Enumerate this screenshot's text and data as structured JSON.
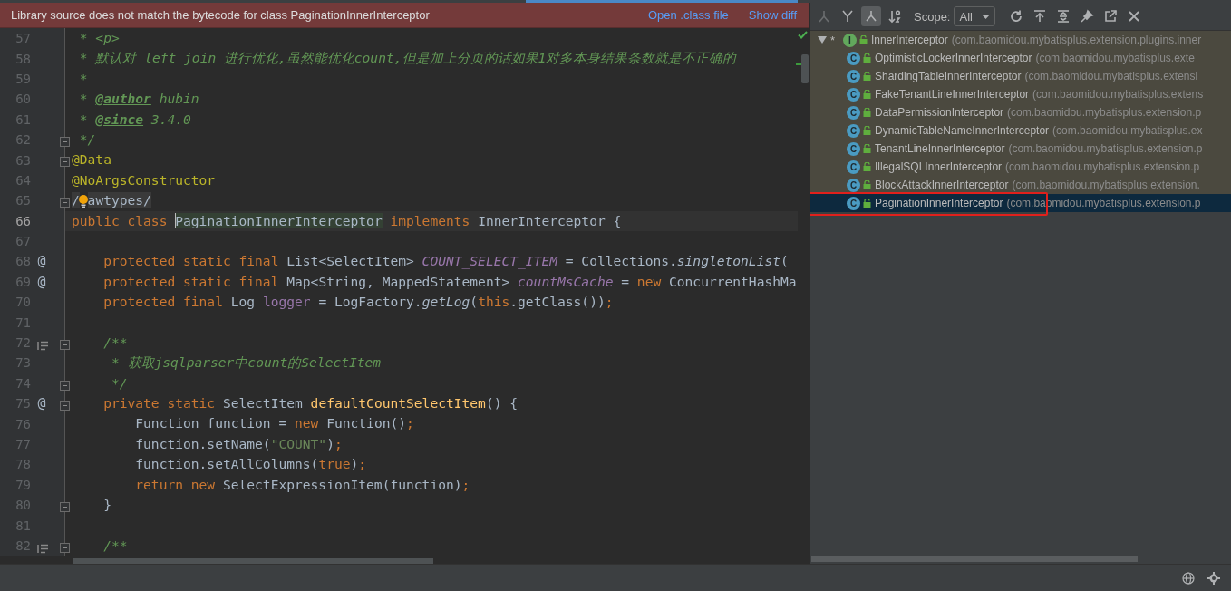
{
  "editor": {
    "banner": {
      "message": "Library source does not match the bytecode for class PaginationInnerInterceptor",
      "links": [
        "Open .class file",
        "Show diff"
      ]
    },
    "lines": [
      {
        "number": "57",
        "fold": false,
        "tokens": [
          {
            "text": " * <p>",
            "kind": "doc"
          }
        ]
      },
      {
        "number": "58",
        "fold": false,
        "tokens": [
          {
            "text": " * 默认对 left join 进行优化,虽然能优化count,但是加上分页的话如果1对多本身结果条数就是不正确的",
            "kind": "doc"
          }
        ]
      },
      {
        "number": "59",
        "fold": false,
        "tokens": [
          {
            "text": " *",
            "kind": "doc"
          }
        ]
      },
      {
        "number": "60",
        "fold": false,
        "tokens": [
          {
            "text": " * ",
            "kind": "doc"
          },
          {
            "text": "@author",
            "kind": "doctag"
          },
          {
            "text": " hubin",
            "kind": "doc"
          }
        ]
      },
      {
        "number": "61",
        "fold": false,
        "tokens": [
          {
            "text": " * ",
            "kind": "doc"
          },
          {
            "text": "@since",
            "kind": "doctag"
          },
          {
            "text": " 3.4.0",
            "kind": "doc"
          }
        ]
      },
      {
        "number": "62",
        "fold": true,
        "tokens": [
          {
            "text": " */",
            "kind": "doc"
          }
        ]
      },
      {
        "number": "63",
        "fold": true,
        "tokens": [
          {
            "text": "@Data",
            "kind": "annotation"
          }
        ]
      },
      {
        "number": "64",
        "fold": false,
        "tokens": [
          {
            "text": "@NoArgsConstructor",
            "kind": "annotation"
          }
        ]
      },
      {
        "number": "65",
        "fold": true,
        "bulb": true,
        "tokens": [
          {
            "text": "/",
            "kind": "folded"
          },
          {
            "text": "awtypes/",
            "kind": "folded"
          }
        ]
      },
      {
        "number": "66",
        "fold": false,
        "current": true,
        "tokens": [
          {
            "text": "public class ",
            "kind": "keyword"
          },
          {
            "text": "PaginationInnerInterceptor",
            "kind": "caret-highlight"
          },
          {
            "text": " implements ",
            "kind": "keyword"
          },
          {
            "text": "InnerInterceptor {",
            "kind": "plain"
          }
        ]
      },
      {
        "number": "67",
        "fold": false
      },
      {
        "number": "68",
        "fold": false,
        "marker": "@",
        "tokens": [
          {
            "text": "    protected static final ",
            "kind": "keyword"
          },
          {
            "text": "List<SelectItem> ",
            "kind": "plain"
          },
          {
            "text": "COUNT_SELECT_ITEM",
            "kind": "constant"
          },
          {
            "text": " = Collections.",
            "kind": "plain"
          },
          {
            "text": "singletonList",
            "kind": "static-call"
          },
          {
            "text": "(",
            "kind": "plain"
          }
        ]
      },
      {
        "number": "69",
        "fold": false,
        "marker": "@",
        "tokens": [
          {
            "text": "    protected static final ",
            "kind": "keyword"
          },
          {
            "text": "Map<String, MappedStatement> ",
            "kind": "plain"
          },
          {
            "text": "countMsCache",
            "kind": "constant"
          },
          {
            "text": " = ",
            "kind": "plain"
          },
          {
            "text": "new ",
            "kind": "keyword"
          },
          {
            "text": "ConcurrentHashMa",
            "kind": "plain"
          }
        ]
      },
      {
        "number": "70",
        "fold": false,
        "tokens": [
          {
            "text": "    protected final ",
            "kind": "keyword"
          },
          {
            "text": "Log ",
            "kind": "plain"
          },
          {
            "text": "logger",
            "kind": "field"
          },
          {
            "text": " = LogFactory.",
            "kind": "plain"
          },
          {
            "text": "getLog",
            "kind": "static-call"
          },
          {
            "text": "(",
            "kind": "plain"
          },
          {
            "text": "this",
            "kind": "keyword"
          },
          {
            "text": ".getClass())",
            "kind": "plain"
          },
          {
            "text": ";",
            "kind": "keyword"
          }
        ]
      },
      {
        "number": "71",
        "fold": false
      },
      {
        "number": "72",
        "fold": true,
        "doc_toggle": true,
        "tokens": [
          {
            "text": "    /**",
            "kind": "doc"
          }
        ]
      },
      {
        "number": "73",
        "fold": false,
        "tokens": [
          {
            "text": "     * 获取jsqlparser中count的SelectItem",
            "kind": "doc"
          }
        ]
      },
      {
        "number": "74",
        "fold": true,
        "tokens": [
          {
            "text": "     */",
            "kind": "doc"
          }
        ]
      },
      {
        "number": "75",
        "fold": true,
        "marker": "@",
        "tokens": [
          {
            "text": "    private static ",
            "kind": "keyword"
          },
          {
            "text": "SelectItem ",
            "kind": "plain"
          },
          {
            "text": "defaultCountSelectItem",
            "kind": "method"
          },
          {
            "text": "() {",
            "kind": "plain"
          }
        ]
      },
      {
        "number": "76",
        "fold": false,
        "tokens": [
          {
            "text": "        Function function = ",
            "kind": "plain"
          },
          {
            "text": "new ",
            "kind": "keyword"
          },
          {
            "text": "Function()",
            "kind": "plain"
          },
          {
            "text": ";",
            "kind": "keyword"
          }
        ]
      },
      {
        "number": "77",
        "fold": false,
        "tokens": [
          {
            "text": "        function.setName(",
            "kind": "plain"
          },
          {
            "text": "\"COUNT\"",
            "kind": "string"
          },
          {
            "text": ")",
            "kind": "plain"
          },
          {
            "text": ";",
            "kind": "keyword"
          }
        ]
      },
      {
        "number": "78",
        "fold": false,
        "tokens": [
          {
            "text": "        function.setAllColumns(",
            "kind": "plain"
          },
          {
            "text": "true",
            "kind": "keyword"
          },
          {
            "text": ")",
            "kind": "plain"
          },
          {
            "text": ";",
            "kind": "keyword"
          }
        ]
      },
      {
        "number": "79",
        "fold": false,
        "tokens": [
          {
            "text": "        return new ",
            "kind": "keyword"
          },
          {
            "text": "SelectExpressionItem(function)",
            "kind": "plain"
          },
          {
            "text": ";",
            "kind": "keyword"
          }
        ]
      },
      {
        "number": "80",
        "fold": true,
        "tokens": [
          {
            "text": "    }",
            "kind": "plain"
          }
        ]
      },
      {
        "number": "81",
        "fold": false
      },
      {
        "number": "82",
        "fold": true,
        "doc_toggle": true,
        "tokens": [
          {
            "text": "    /**",
            "kind": "doc"
          }
        ]
      }
    ]
  },
  "hierarchy": {
    "toolbar": {
      "view_buttons": [
        {
          "selected": false,
          "disabled": true
        },
        {
          "selected": false,
          "disabled": false
        },
        {
          "selected": true,
          "disabled": false
        },
        {
          "selected": false,
          "disabled": false
        }
      ],
      "scope_label": "Scope:",
      "scope_value": "All"
    },
    "tree": {
      "name": "InnerInterceptor",
      "package": "(com.baomidou.mybatisplus.extension.plugins.inner",
      "marker": "*",
      "kind": "interface",
      "type_letter": "I",
      "expanded": true,
      "selected": false,
      "children": [
        {
          "name": "OptimisticLockerInnerInterceptor",
          "package": "(com.baomidou.mybatisplus.exte",
          "kind": "class",
          "type_letter": "C",
          "selected": false
        },
        {
          "name": "ShardingTableInnerInterceptor",
          "package": "(com.baomidou.mybatisplus.extensi",
          "kind": "class",
          "type_letter": "C",
          "selected": false
        },
        {
          "name": "FakeTenantLineInnerInterceptor",
          "package": "(com.baomidou.mybatisplus.extens",
          "kind": "class",
          "type_letter": "C",
          "selected": false
        },
        {
          "name": "DataPermissionInterceptor",
          "package": "(com.baomidou.mybatisplus.extension.p",
          "kind": "class",
          "type_letter": "C",
          "selected": false
        },
        {
          "name": "DynamicTableNameInnerInterceptor",
          "package": "(com.baomidou.mybatisplus.ex",
          "kind": "class",
          "type_letter": "C",
          "selected": false
        },
        {
          "name": "TenantLineInnerInterceptor",
          "package": "(com.baomidou.mybatisplus.extension.p",
          "kind": "class",
          "type_letter": "C",
          "selected": false
        },
        {
          "name": "IllegalSQLInnerInterceptor",
          "package": "(com.baomidou.mybatisplus.extension.p",
          "kind": "class",
          "type_letter": "C",
          "selected": false
        },
        {
          "name": "BlockAttackInnerInterceptor",
          "package": "(com.baomidou.mybatisplus.extension.",
          "kind": "class",
          "type_letter": "C",
          "selected": false
        },
        {
          "name": "PaginationInnerInterceptor",
          "package": "(com.baomidou.mybatisplus.extension.p",
          "kind": "class",
          "type_letter": "C",
          "selected": true
        }
      ]
    }
  }
}
